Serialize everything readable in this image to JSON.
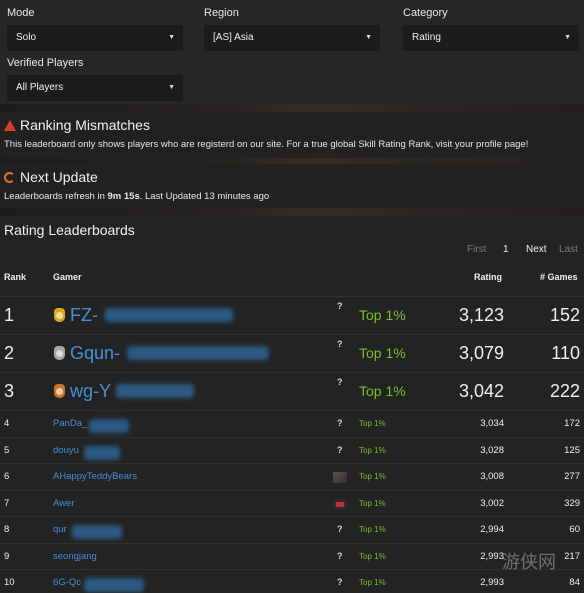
{
  "filters": {
    "mode": {
      "label": "Mode",
      "value": "Solo"
    },
    "region": {
      "label": "Region",
      "value": "[AS] Asia"
    },
    "category": {
      "label": "Category",
      "value": "Rating"
    },
    "verified": {
      "label": "Verified Players",
      "value": "All Players"
    }
  },
  "notice": {
    "title": "Ranking Mismatches",
    "text": "This leaderboard only shows players who are registerd on our site. For a true global Skill Rating Rank, visit your profile page!"
  },
  "update": {
    "title": "Next Update",
    "text_prefix": "Leaderboards refresh in ",
    "countdown": "9m 15s",
    "text_suffix": ". Last Updated 13 minutes ago"
  },
  "board": {
    "title": "Rating Leaderboards",
    "pager": {
      "first": "First",
      "page": "1",
      "next": "Next",
      "last": "Last"
    },
    "headers": {
      "rank": "Rank",
      "gamer": "Gamer",
      "rating": "Rating",
      "games": "# Games"
    },
    "rows": [
      {
        "rank": "1",
        "gamer": "FZ-",
        "tag": "?",
        "top": "Top 1%",
        "rating": "3,123",
        "games": "152"
      },
      {
        "rank": "2",
        "gamer": "Gqun-",
        "tag": "?",
        "top": "Top 1%",
        "rating": "3,079",
        "games": "110"
      },
      {
        "rank": "3",
        "gamer": "wg-Y",
        "tag": "?",
        "top": "Top 1%",
        "rating": "3,042",
        "games": "222"
      },
      {
        "rank": "4",
        "gamer": "PanDa_",
        "tag": "?",
        "top": "Top 1%",
        "rating": "3,034",
        "games": "172"
      },
      {
        "rank": "5",
        "gamer": "douyu",
        "tag": "?",
        "top": "Top 1%",
        "rating": "3,028",
        "games": "125"
      },
      {
        "rank": "6",
        "gamer": "AHappyTeddyBears",
        "tag": "",
        "top": "Top 1%",
        "rating": "3,008",
        "games": "277"
      },
      {
        "rank": "7",
        "gamer": "Awer",
        "tag": "",
        "top": "Top 1%",
        "rating": "3,002",
        "games": "329"
      },
      {
        "rank": "8",
        "gamer": "qur",
        "tag": "?",
        "top": "Top 1%",
        "rating": "2,994",
        "games": "60"
      },
      {
        "rank": "9",
        "gamer": "seongjang",
        "tag": "?",
        "top": "Top 1%",
        "rating": "2,993",
        "games": "217"
      },
      {
        "rank": "10",
        "gamer": "6G-Qc",
        "tag": "?",
        "top": "Top 1%",
        "rating": "2,993",
        "games": "84"
      }
    ]
  },
  "watermark": "游侠网"
}
